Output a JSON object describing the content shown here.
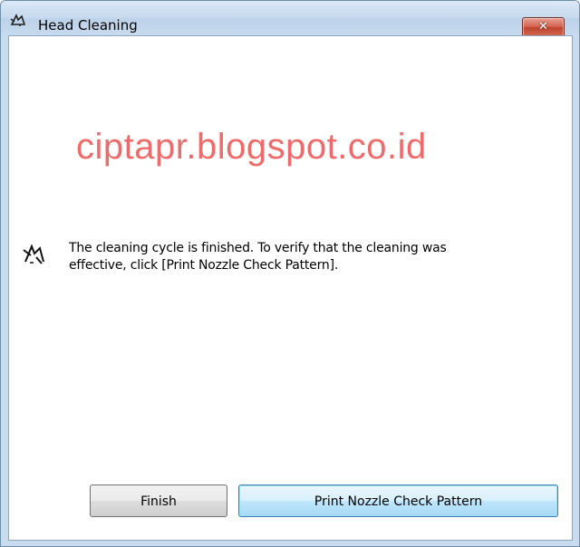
{
  "window": {
    "title": "Head Cleaning",
    "title_icon": "printer-cleaning-icon",
    "close_label": "✕"
  },
  "watermark": {
    "text": "ciptapr.blogspot.co.id",
    "color": "#ef6b6b"
  },
  "message": {
    "icon": "printer-cleaning-icon",
    "text": "The cleaning cycle is finished. To verify that the cleaning was effective, click [Print Nozzle Check Pattern]."
  },
  "buttons": {
    "finish": "Finish",
    "print_nozzle": "Print Nozzle Check Pattern"
  },
  "colors": {
    "titlebar": "#c6d9ee",
    "close_button": "#c0422d",
    "default_button_border": "#3c7fb1"
  }
}
